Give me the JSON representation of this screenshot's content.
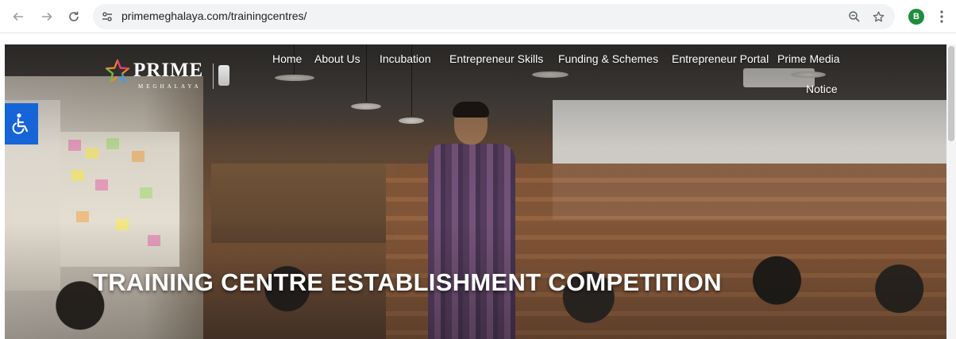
{
  "browser": {
    "url": "primemeghalaya.com/trainingcentres/",
    "back_icon": "arrow-left",
    "forward_icon": "arrow-right",
    "reload_icon": "reload",
    "site_info_icon": "tune",
    "zoom_icon": "magnifier-minus",
    "bookmark_icon": "star-outline",
    "profile_initial": "B",
    "profile_color": "#1e8e3e",
    "menu_icon": "vertical-ellipsis"
  },
  "site": {
    "logo": {
      "name": "PRIME",
      "subtitle": "MEGHALAYA"
    },
    "nav": {
      "items": [
        {
          "label": "Home"
        },
        {
          "label": "About Us"
        },
        {
          "label": "Incubation"
        },
        {
          "label": "Entrepreneur Skills"
        },
        {
          "label": "Funding & Schemes"
        },
        {
          "label": "Entrepreneur Portal"
        },
        {
          "label": "Prime Media"
        },
        {
          "label": "Notice"
        }
      ]
    },
    "accessibility": {
      "icon": "wheelchair-icon",
      "color": "#1565d8"
    },
    "hero": {
      "title": "TRAINING CENTRE ESTABLISHMENT COMPETITION"
    }
  }
}
